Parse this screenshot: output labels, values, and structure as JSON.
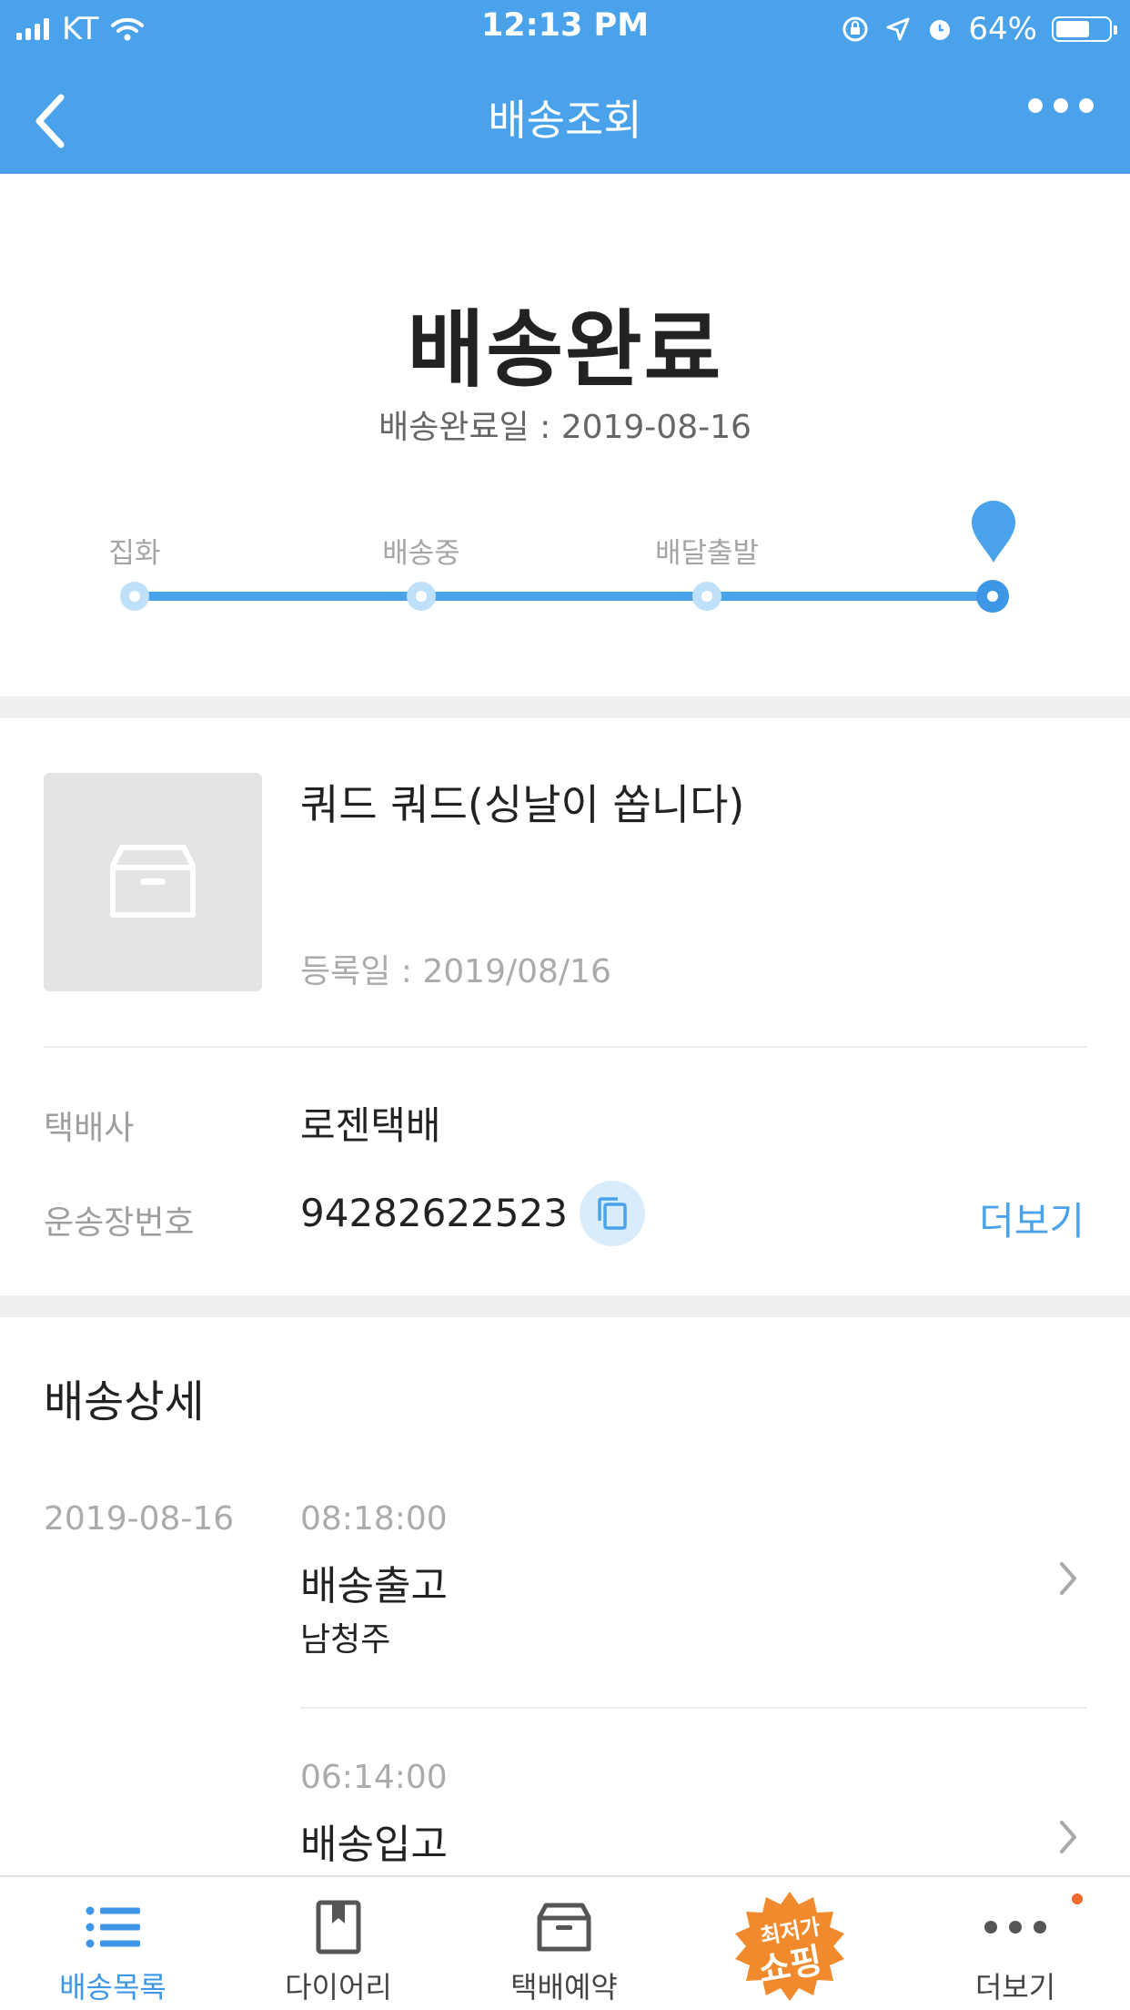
{
  "status_bar": {
    "carrier": "KT",
    "time": "12:13 PM",
    "battery": "64%"
  },
  "nav": {
    "title": "배송조회"
  },
  "hero": {
    "title": "배송완료",
    "date_text": "배송완료일 : 2019-08-16"
  },
  "progress": {
    "steps": [
      {
        "label": "집화"
      },
      {
        "label": "배송중"
      },
      {
        "label": "배달출발"
      },
      {
        "label": ""
      }
    ],
    "current_step": 4
  },
  "package": {
    "name": "쿼드 쿼드(싱날이 쏩니다)",
    "registered": "등록일 : 2019/08/16"
  },
  "info": {
    "courier_label": "택배사",
    "courier_value": "로젠택배",
    "tracking_label": "운송장번호",
    "tracking_value": "94282622523",
    "more_label": "더보기"
  },
  "detail": {
    "title": "배송상세",
    "date": "2019-08-16",
    "events": [
      {
        "time": "08:18:00",
        "status": "배송출고",
        "location": "남청주"
      },
      {
        "time": "06:14:00",
        "status": "배송입고",
        "location": ""
      }
    ]
  },
  "tabbar": {
    "items": [
      {
        "label": "배송목록"
      },
      {
        "label": "다이어리"
      },
      {
        "label": "택배예약"
      },
      {
        "label": ""
      },
      {
        "label": "더보기"
      }
    ],
    "shopping_badge": {
      "line1": "최저가",
      "line2": "쇼핑"
    }
  },
  "colors": {
    "primary": "#4aa3ea",
    "background": "#ffffff",
    "badge": "#ef6a2b"
  }
}
